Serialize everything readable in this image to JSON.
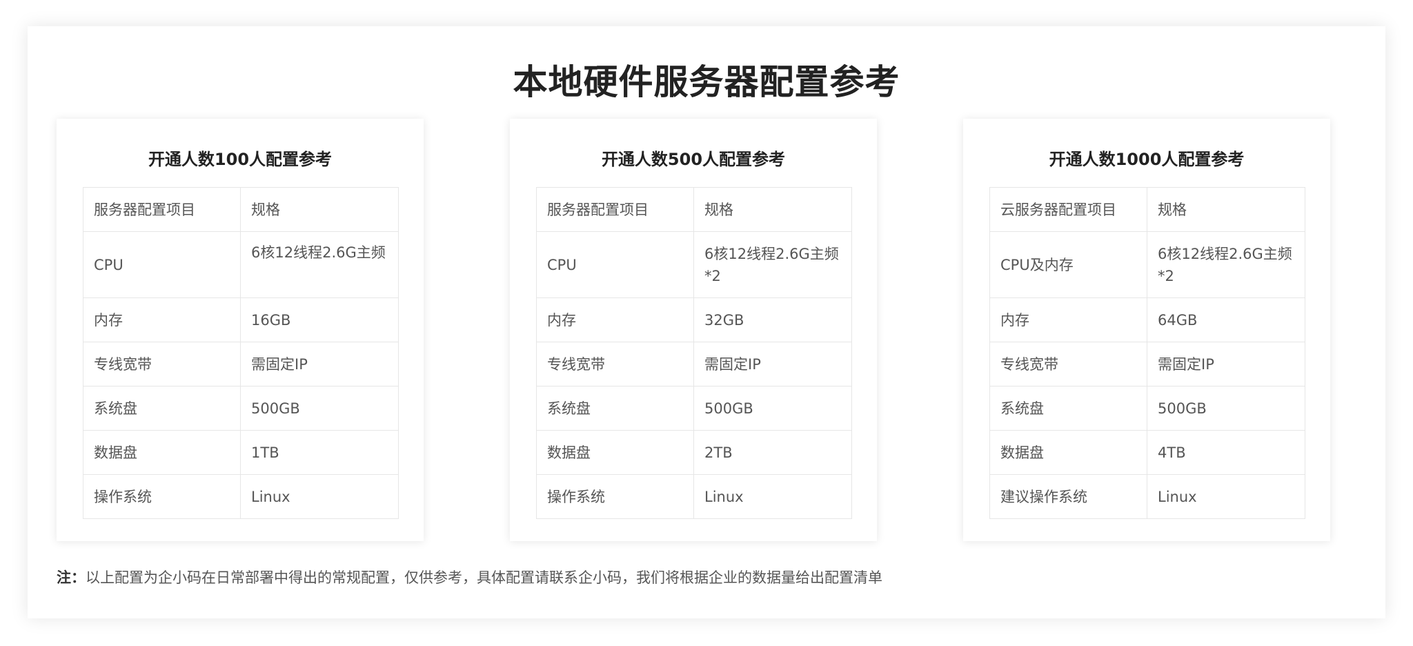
{
  "page": {
    "title": "本地硬件服务器配置参考"
  },
  "cards": [
    {
      "title": "开通人数100人配置参考",
      "rows": [
        [
          "服务器配置项目",
          "规格"
        ],
        [
          "CPU",
          "6核12线程2.6G主频"
        ],
        [
          "内存",
          "16GB"
        ],
        [
          "专线宽带",
          "需固定IP"
        ],
        [
          "系统盘",
          "500GB"
        ],
        [
          "数据盘",
          "1TB"
        ],
        [
          "操作系统",
          "Linux"
        ]
      ]
    },
    {
      "title": "开通人数500人配置参考",
      "rows": [
        [
          "服务器配置项目",
          "规格"
        ],
        [
          "CPU",
          "6核12线程2.6G主频*2"
        ],
        [
          "内存",
          "32GB"
        ],
        [
          "专线宽带",
          "需固定IP"
        ],
        [
          "系统盘",
          "500GB"
        ],
        [
          "数据盘",
          "2TB"
        ],
        [
          "操作系统",
          "Linux"
        ]
      ]
    },
    {
      "title": "开通人数1000人配置参考",
      "rows": [
        [
          "云服务器配置项目",
          "规格"
        ],
        [
          "CPU及内存",
          "6核12线程2.6G主频*2"
        ],
        [
          "内存",
          "64GB"
        ],
        [
          "专线宽带",
          "需固定IP"
        ],
        [
          "系统盘",
          "500GB"
        ],
        [
          "数据盘",
          "4TB"
        ],
        [
          "建议操作系统",
          "Linux"
        ]
      ]
    }
  ],
  "note": {
    "label": "注：",
    "text": "以上配置为企小码在日常部署中得出的常规配置，仅供参考，具体配置请联系企小码，我们将根据企业的数据量给出配置清单"
  }
}
